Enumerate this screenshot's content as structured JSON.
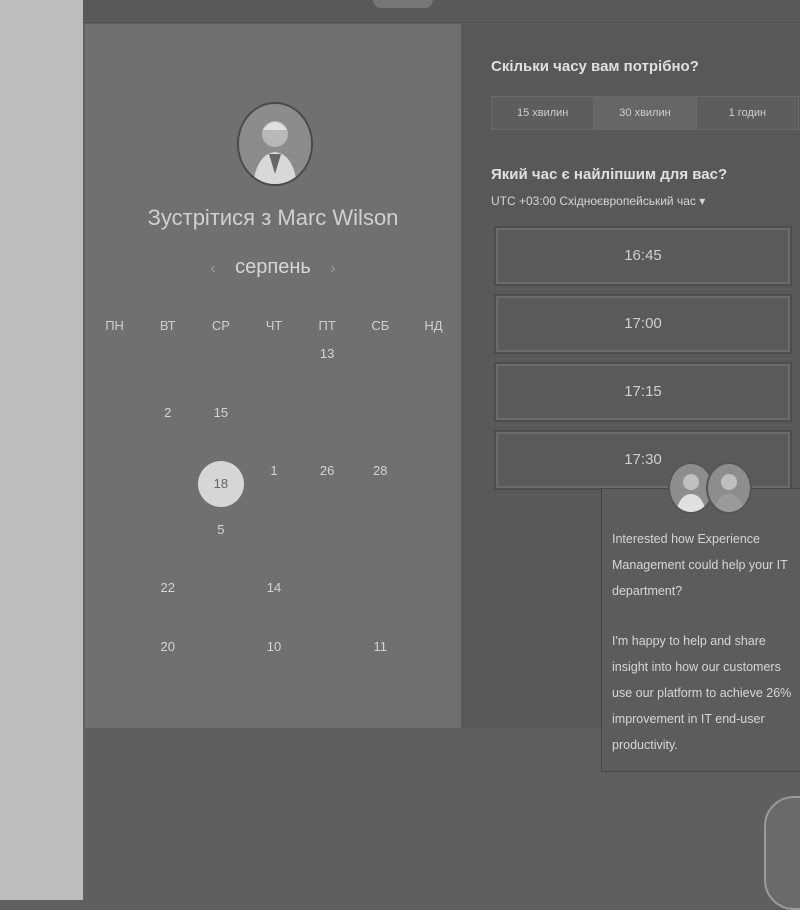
{
  "meeting": {
    "title": "Зустрітися з Marc Wilson",
    "month": "серпень",
    "prev_label": "‹",
    "next_label": "›"
  },
  "calendar": {
    "weekdays": [
      "ПН",
      "ВТ",
      "СР",
      "ЧТ",
      "ПТ",
      "СБ",
      "НД"
    ],
    "weeks": [
      [
        {
          "d": ""
        },
        {
          "d": ""
        },
        {
          "d": ""
        },
        {
          "d": ""
        },
        {
          "d": "13",
          "a": true
        },
        {
          "d": ""
        },
        {
          "d": ""
        }
      ],
      [
        {
          "d": ""
        },
        {
          "d": "2",
          "a": true
        },
        {
          "d": "15",
          "a": true
        },
        {
          "d": ""
        },
        {
          "d": ""
        },
        {
          "d": ""
        },
        {
          "d": ""
        }
      ],
      [
        {
          "d": ""
        },
        {
          "d": ""
        },
        {
          "d": "18",
          "a": true,
          "s": true
        },
        {
          "d": "1",
          "a": true
        },
        {
          "d": "26",
          "a": true
        },
        {
          "d": "28",
          "a": true
        },
        {
          "d": ""
        }
      ],
      [
        {
          "d": ""
        },
        {
          "d": ""
        },
        {
          "d": "5",
          "a": true
        },
        {
          "d": ""
        },
        {
          "d": ""
        },
        {
          "d": ""
        },
        {
          "d": ""
        }
      ],
      [
        {
          "d": ""
        },
        {
          "d": "22",
          "a": true
        },
        {
          "d": ""
        },
        {
          "d": "14",
          "a": true
        },
        {
          "d": ""
        },
        {
          "d": ""
        },
        {
          "d": ""
        }
      ],
      [
        {
          "d": ""
        },
        {
          "d": "20",
          "a": true
        },
        {
          "d": ""
        },
        {
          "d": "10",
          "a": true
        },
        {
          "d": ""
        },
        {
          "d": "11",
          "a": true
        },
        {
          "d": ""
        }
      ]
    ]
  },
  "duration": {
    "question": "Скільки часу вам потрібно?",
    "options": [
      "15 хвилин",
      "30 хвилин",
      "1 годин"
    ],
    "selected": "30 хвилин"
  },
  "time": {
    "question": "Який час є найліпшим для вас?",
    "timezone": "UTC +03:00 Східноєвропейський час",
    "timezone_caret": "▾",
    "slots": [
      "16:45",
      "17:00",
      "17:15",
      "17:30"
    ]
  },
  "chat": {
    "paragraph1": "Interested how Experience Management could help your IT department?",
    "paragraph2": "I'm happy to help and share insight into how our customers use our platform to achieve 26% improvement in IT end-user productivity."
  },
  "colors": {
    "accent": "#d6d6d6",
    "panel": "#707070"
  }
}
